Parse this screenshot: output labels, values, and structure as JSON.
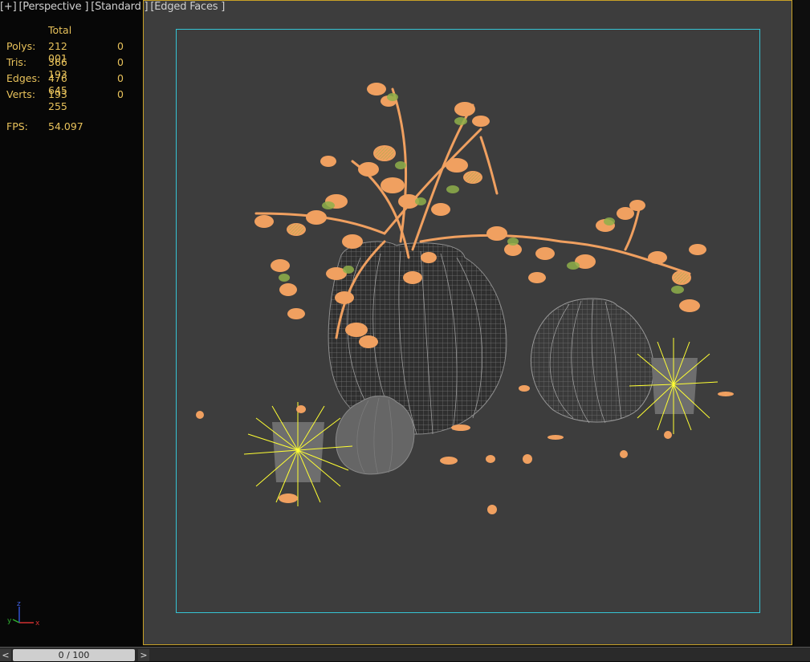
{
  "viewport_labels": {
    "plus": "[+]",
    "view": "[Perspective ]",
    "shading": "[Standard ]",
    "mode": "[Edged Faces ]"
  },
  "stats": {
    "header": "Total",
    "rows": [
      {
        "label": "Polys:",
        "total": "212 001",
        "selected": "0"
      },
      {
        "label": "Tris:",
        "total": "366 193",
        "selected": "0"
      },
      {
        "label": "Edges:",
        "total": "476 645",
        "selected": "0"
      },
      {
        "label": "Verts:",
        "total": "193 255",
        "selected": "0"
      }
    ],
    "fps_label": "FPS:",
    "fps_value": "54.097"
  },
  "gizmo": {
    "x": "x",
    "y": "y",
    "z": "z"
  },
  "timeline": {
    "prev": "<",
    "next": ">",
    "frame": "0 / 100"
  },
  "colors": {
    "viewport_bg": "#3d3d3d",
    "active_border": "#c9a227",
    "safe_frame": "#35c3d3",
    "stats_text": "#e8c25b",
    "foliage": "#f0a060",
    "light_rays": "#ffff33",
    "vase_wire": "#9a9a9a"
  }
}
